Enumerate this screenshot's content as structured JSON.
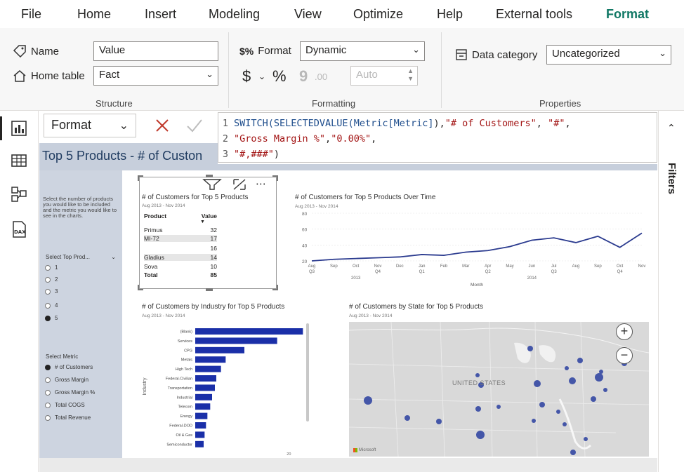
{
  "menu": {
    "items": [
      "File",
      "Home",
      "Insert",
      "Modeling",
      "View",
      "Optimize",
      "Help",
      "External tools",
      "Format"
    ],
    "active": "Format"
  },
  "ribbon": {
    "structure": {
      "label": "Structure",
      "name_label": "Name",
      "name_value": "Value",
      "home_table_label": "Home table",
      "home_table_value": "Fact"
    },
    "formatting": {
      "label": "Formatting",
      "format_label": "Format",
      "format_value": "Dynamic",
      "currency_symbol": "$",
      "percent_symbol": "%",
      "comma_symbol": "9",
      "decimal_symbol": ".00",
      "auto_value": "Auto"
    },
    "properties": {
      "label": "Properties",
      "data_category_label": "Data category",
      "data_category_value": "Uncategorized"
    }
  },
  "formula_bar": {
    "selector": "Format",
    "lines": [
      {
        "num": "1",
        "parts": [
          {
            "t": "kw",
            "v": "SWITCH(SELECTEDVALUE("
          },
          {
            "t": "kw",
            "v": "Metric[Metric]"
          },
          {
            "t": "pn",
            "v": "),"
          },
          {
            "t": "str",
            "v": "\"# of Customers\""
          },
          {
            "t": "pn",
            "v": ", "
          },
          {
            "t": "str",
            "v": "\"#\""
          },
          {
            "t": "pn",
            "v": ","
          }
        ]
      },
      {
        "num": "2",
        "parts": [
          {
            "t": "str",
            "v": "\"Gross Margin %\""
          },
          {
            "t": "pn",
            "v": ","
          },
          {
            "t": "str",
            "v": "\"0.00%\""
          },
          {
            "t": "pn",
            "v": ","
          }
        ]
      },
      {
        "num": "3",
        "parts": [
          {
            "t": "str",
            "v": "\"#,###\""
          },
          {
            "t": "pn",
            "v": ")"
          }
        ]
      }
    ]
  },
  "right_pane": {
    "label": "Filters"
  },
  "report": {
    "page_title": "Top 5 Products - # of Custon",
    "slicer_help": "Select the number of products you would like to be included and the metric you would like to see in the charts.",
    "top_prod_label": "Select Top Prod...",
    "top_options": [
      "1",
      "2",
      "3",
      "4",
      "5"
    ],
    "top_selected": "5",
    "metric_label": "Select Metric",
    "metric_options": [
      "# of Customers",
      "Gross Margin",
      "Gross Margin %",
      "Total COGS",
      "Total Revenue"
    ],
    "metric_selected": "# of Customers",
    "date_range": "Aug 2013 - Nov 2014",
    "table_visual": {
      "title": "# of Customers for Top 5 Products",
      "headers": [
        "Product",
        "Value"
      ],
      "rows": [
        {
          "product": "Primus",
          "value": "32"
        },
        {
          "product": "MI-72",
          "value": "17"
        },
        {
          "product": "",
          "value": "16"
        },
        {
          "product": "Gladius",
          "value": "14"
        },
        {
          "product": "Sova",
          "value": "10"
        }
      ],
      "total_label": "Total",
      "total_value": "85"
    },
    "line_visual": {
      "title": "# of Customers for Top 5 Products Over Time",
      "xlabel": "Month"
    },
    "bar_visual": {
      "title": "# of Customers by Industry for Top 5 Products",
      "ylabel": "Industry",
      "xtick": "20"
    },
    "map_visual": {
      "title": "# of Customers by State for Top 5 Products",
      "country_label": "UNITED STATES",
      "attribution": "Microsoft",
      "zoom_in": "+",
      "zoom_out": "−"
    }
  },
  "chart_data": [
    {
      "type": "line",
      "title": "# of Customers for Top 5 Products Over Time",
      "xlabel": "Month",
      "ylabel": "",
      "x": [
        "Aug",
        "Sep",
        "Oct",
        "Nov",
        "Dec",
        "Jan",
        "Feb",
        "Mar",
        "Apr",
        "May",
        "Jun",
        "Jul",
        "Aug",
        "Sep",
        "Oct",
        "Nov"
      ],
      "quarters": [
        "Q3",
        "",
        "",
        "Q4",
        "",
        "Q1",
        "",
        "",
        "Q2",
        "",
        "",
        "Q3",
        "",
        "",
        "Q4",
        ""
      ],
      "years": [
        "2013",
        "2014"
      ],
      "values": [
        20,
        22,
        23,
        24,
        25,
        28,
        27,
        31,
        33,
        38,
        46,
        49,
        43,
        51,
        37,
        55
      ],
      "ylim": [
        20,
        80
      ],
      "yticks": [
        20,
        40,
        60,
        80
      ],
      "color": "#2b3b8f"
    },
    {
      "type": "bar",
      "orientation": "horizontal",
      "title": "# of Customers by Industry for Top 5 Products",
      "ylabel": "Industry",
      "categories": [
        "(Blank)",
        "Services",
        "CPG",
        "Metals",
        "High Tech",
        "Federal-Civilian",
        "Transportation",
        "Industrial",
        "Telecom",
        "Energy",
        "Federal-DOD",
        "Oil & Gas",
        "Semiconductor"
      ],
      "values": [
        23,
        17.5,
        10.5,
        6.5,
        5.5,
        4.5,
        4.2,
        3.6,
        3.2,
        2.6,
        2.3,
        2,
        1.8
      ],
      "xlim": [
        0,
        21
      ],
      "color": "#1a2fa8"
    }
  ]
}
